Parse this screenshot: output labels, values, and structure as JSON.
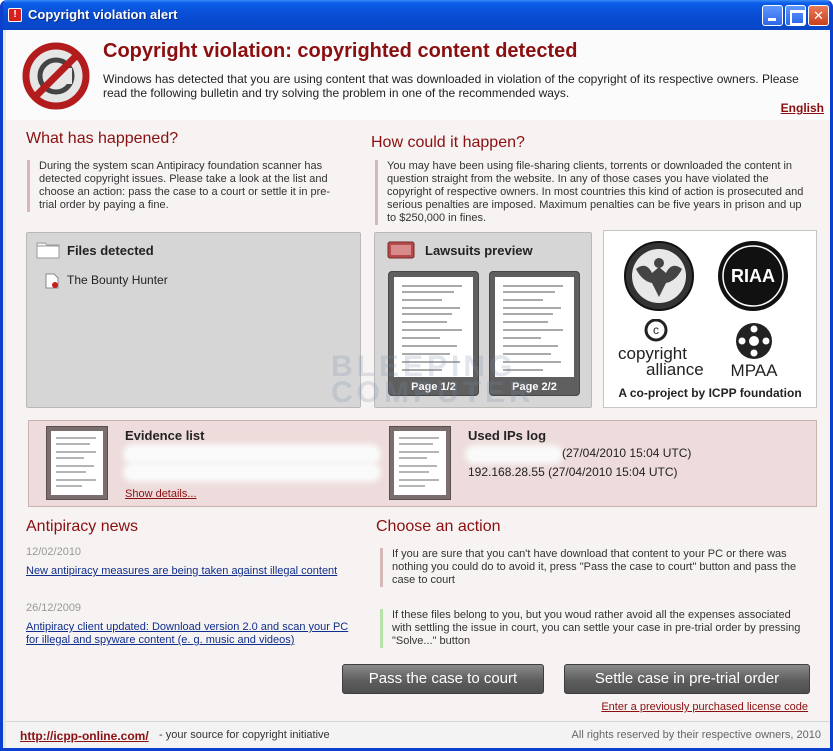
{
  "window": {
    "title": "Copyright violation alert"
  },
  "header": {
    "title": "Copyright violation: copyrighted content detected",
    "description": "Windows has detected that you are using content that was downloaded in violation of the copyright of its respective owners. Please read the following bulletin and try solving the problem in one of the recommended ways.",
    "language_link": "English"
  },
  "what_happened": {
    "title": "What has happened?",
    "text": "During the system scan Antipiracy foundation scanner has detected copyright issues. Please take a look at the list and choose an action: pass the case to a court or settle it in pre-trial order by paying a fine."
  },
  "how_happened": {
    "title": "How could it happen?",
    "text": "You may have been using file-sharing clients, torrents or downloaded the content in question straight from the website. In any of those cases you have violated the copyright of respective owners. In most countries this kind of action is prosecuted and serious penalties are imposed. Maximum penalties can be five years in prison and up to $250,000 in fines."
  },
  "files_detected": {
    "title": "Files detected",
    "items": [
      "The Bounty Hunter"
    ]
  },
  "lawsuits": {
    "title": "Lawsuits preview",
    "pages": [
      "Page 1/2",
      "Page 2/2"
    ]
  },
  "partners": {
    "logos": [
      "RIAA",
      "copyright",
      "alliance",
      "MPAA"
    ],
    "caption": "A co-project by ICPP foundation"
  },
  "evidence": {
    "title": "Evidence list",
    "show_details": "Show details...",
    "ips_title": "Used IPs log",
    "ip_rows": [
      "(27/04/2010 15:04 UTC)",
      "192.168.28.55 (27/04/2010 15:04 UTC)"
    ]
  },
  "news": {
    "title": "Antipiracy news",
    "items": [
      {
        "date": "12/02/2010",
        "text": "New antipiracy measures are being taken against illegal content"
      },
      {
        "date": "26/12/2009",
        "text": "Antipiracy client updated: Download version 2.0 and scan your PC for illegal and spyware content (e. g. music and videos)"
      }
    ]
  },
  "action": {
    "title": "Choose an action",
    "option1": "If you are sure that you can't have download that content to your PC or there was nothing you could do to avoid it, press \"Pass the case to court\" button and pass the case to court",
    "option2": "If these files belong to you, but you woud rather avoid all the expenses associated with settling the issue in court, you can settle your case in pre-trial order by pressing \"Solve...\" button",
    "court_button": "Pass the case to court",
    "settle_button": "Settle case in pre-trial order",
    "license_link": "Enter a previously purchased license code"
  },
  "watermark": {
    "line1": "BLEEPING",
    "line2": "COMPUTER"
  },
  "footer": {
    "url": "http://icpp-online.com/",
    "tagline": " - your source for copyright initiative",
    "rights": "All rights reserved by their respective owners, 2010"
  },
  "colors": {
    "accent": "#8b0f10",
    "titlebar": "#0a4fd6",
    "panel": "#d6d6d6",
    "evidence_bg": "#eddcdb"
  }
}
